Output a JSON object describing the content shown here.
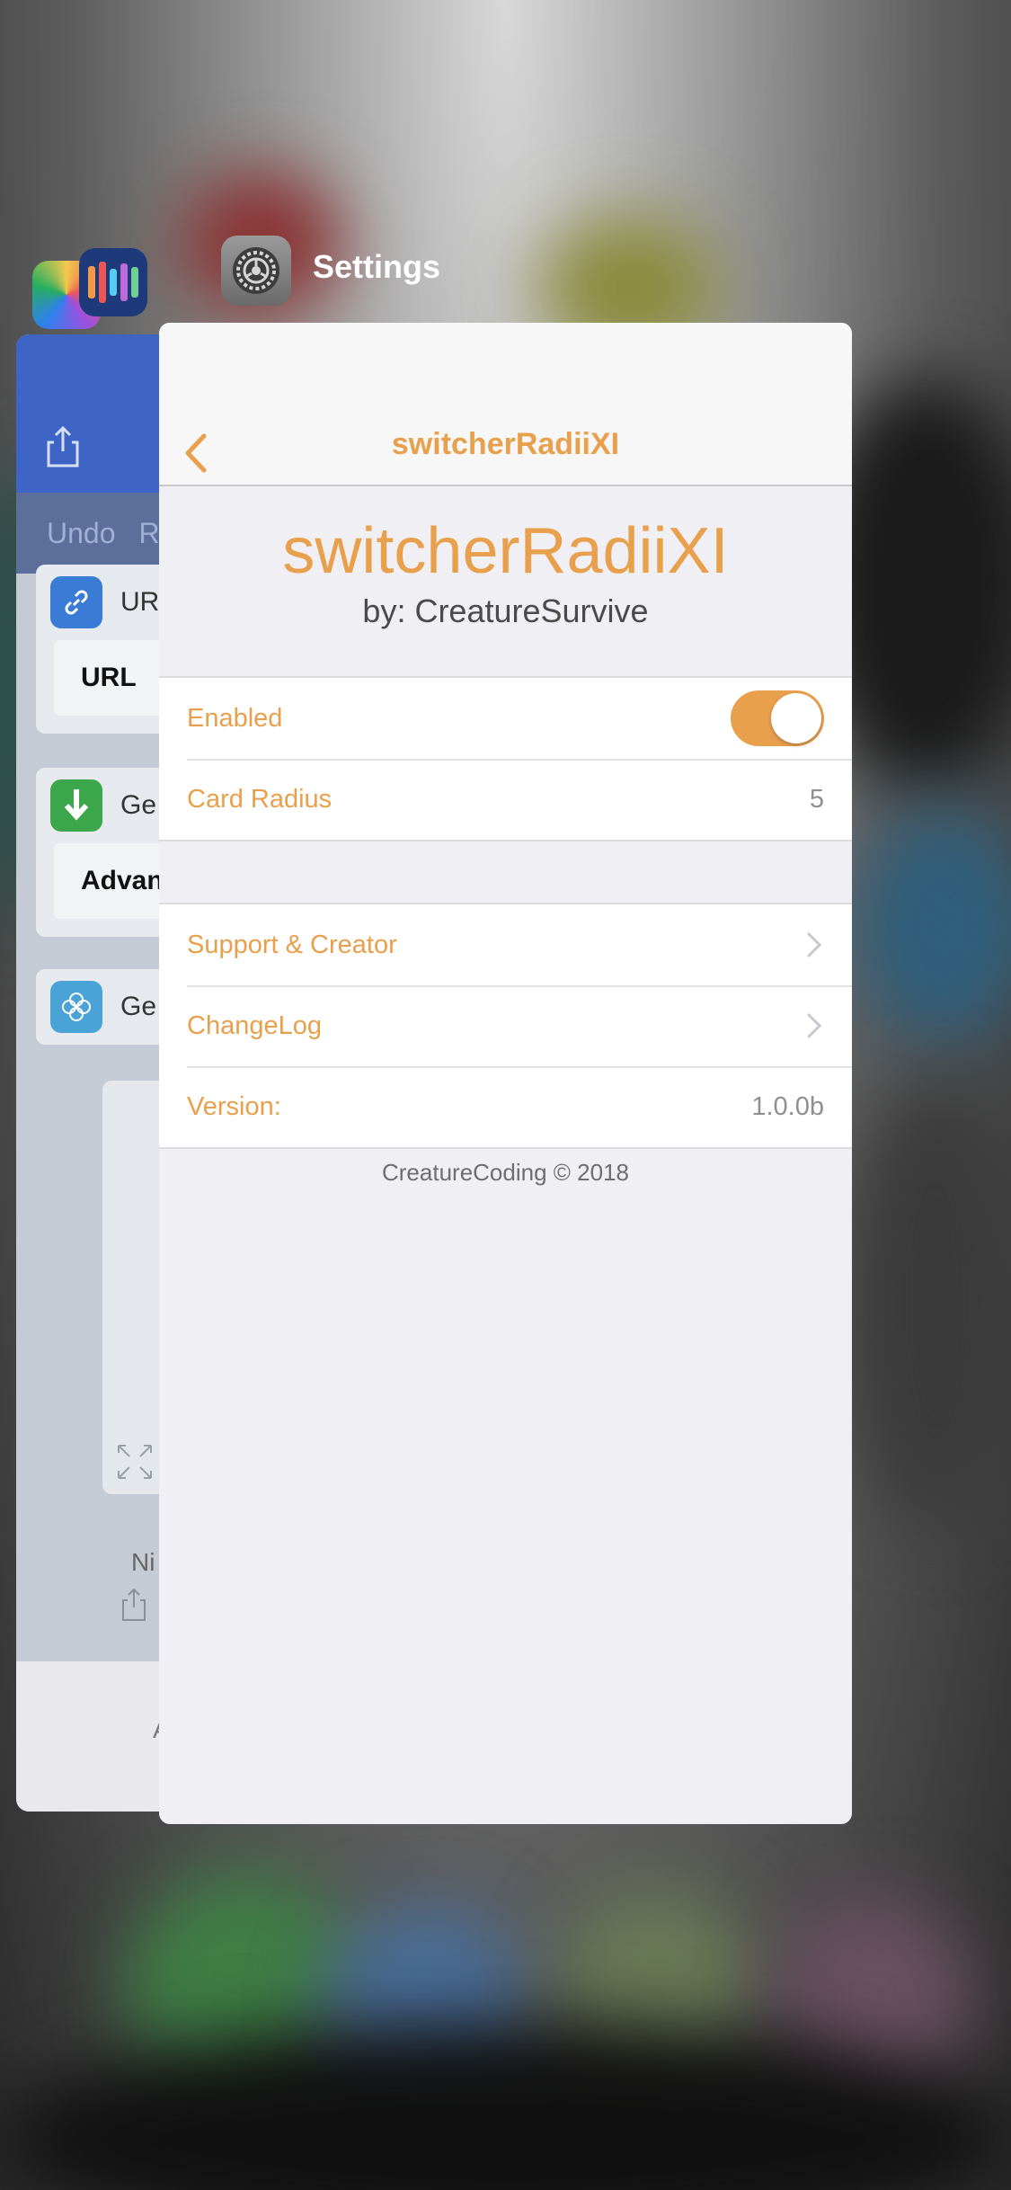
{
  "switcher": {
    "foreground_app_name": "Settings"
  },
  "background_app": {
    "toolbar": {
      "undo_label": "Undo",
      "redo_label": "Re"
    },
    "actions": [
      {
        "label": "UR",
        "field": "URL",
        "color": "#3a7bd5",
        "icon": "link-icon"
      },
      {
        "label": "Ge",
        "field": "Advanc",
        "color": "#3ca64a",
        "icon": "download-icon"
      },
      {
        "label": "Ge",
        "field": "",
        "color": "#4aa3d6",
        "icon": "flower-icon"
      }
    ],
    "note_text": "Ni",
    "bottom_text": "A"
  },
  "settings": {
    "nav_title": "switcherRadiiXI",
    "hero_title": "switcherRadiiXI",
    "hero_subtitle": "by: CreatureSurvive",
    "accent_color": "#e9a04d",
    "group1": {
      "enabled_label": "Enabled",
      "enabled_on": true,
      "radius_label": "Card Radius",
      "radius_value": "5"
    },
    "group2": {
      "support_label": "Support & Creator",
      "changelog_label": "ChangeLog",
      "version_label": "Version:",
      "version_value": "1.0.0b"
    },
    "footer": "CreatureCoding © 2018"
  }
}
